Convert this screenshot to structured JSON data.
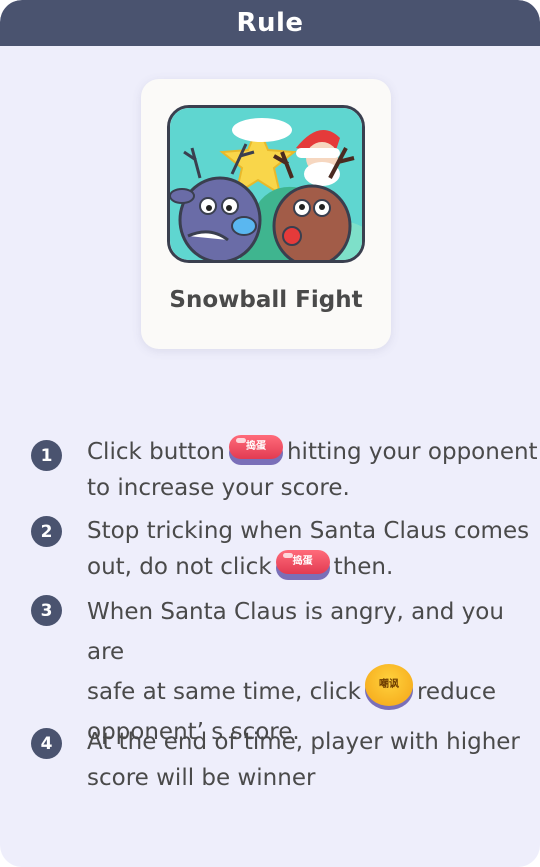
{
  "header": {
    "title": "Rule"
  },
  "game": {
    "title": "Snowball Fight",
    "image_icon": "reindeer-santa-game-thumbnail"
  },
  "rules": [
    {
      "number": "1",
      "before": "Click button",
      "button_label": "捣蛋",
      "after": "hitting your opponent",
      "line2": "to increase your score."
    },
    {
      "number": "2",
      "line1": "Stop tricking when Santa Claus comes",
      "before": "out, do not click",
      "button_label": "捣蛋",
      "after": "then."
    },
    {
      "number": "3",
      "line1": "When Santa Claus is angry, and you are",
      "before": "safe at same time, click",
      "button_label": "嘲讽",
      "after": "reduce",
      "line3": "opponent’ s score."
    },
    {
      "number": "4",
      "line1": "At the end of time, player with higher",
      "line2": "score will be winner"
    }
  ],
  "colors": {
    "header": "#4a536f",
    "panel": "#eeeefb",
    "text": "#4a4a4a",
    "card": "#fbfaf8"
  }
}
